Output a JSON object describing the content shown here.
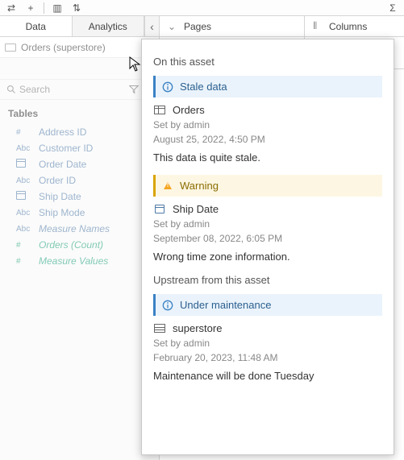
{
  "toolbar": {
    "icons": [
      "undo",
      "redo",
      "new-sheet",
      "duplicate",
      "swap",
      "sort-asc",
      "sort-desc",
      "highlight"
    ]
  },
  "side_tabs": {
    "data": "Data",
    "analytics": "Analytics"
  },
  "datasource": {
    "name": "Orders (superstore)"
  },
  "search": {
    "placeholder": "Search"
  },
  "section": {
    "tables": "Tables"
  },
  "fields": [
    {
      "type": "#",
      "cls": "dim",
      "name": "Address ID"
    },
    {
      "type": "Abc",
      "cls": "dim",
      "name": "Customer ID"
    },
    {
      "type": "cal",
      "cls": "dim",
      "name": "Order Date"
    },
    {
      "type": "Abc",
      "cls": "dim",
      "name": "Order ID"
    },
    {
      "type": "cal",
      "cls": "dim",
      "name": "Ship Date"
    },
    {
      "type": "Abc",
      "cls": "dim",
      "name": "Ship Mode"
    },
    {
      "type": "Abc",
      "cls": "dim italic",
      "name": "Measure Names"
    },
    {
      "type": "#",
      "cls": "mea italic",
      "name": "Orders (Count)"
    },
    {
      "type": "#",
      "cls": "mea italic",
      "name": "Measure Values"
    }
  ],
  "shelves": {
    "pages": "Pages",
    "columns": "Columns"
  },
  "popover": {
    "section1": "On this asset",
    "section2": "Upstream from this asset",
    "items": [
      {
        "banner_type": "info",
        "banner_label": "Stale data",
        "obj_label": "Orders",
        "obj_icon": "table",
        "set_by": "Set by admin",
        "timestamp": "August 25, 2022, 4:50 PM",
        "message": "This data is quite stale."
      },
      {
        "banner_type": "warn",
        "banner_label": "Warning",
        "obj_label": "Ship Date",
        "obj_icon": "calendar",
        "set_by": "Set by admin",
        "timestamp": "September 08, 2022, 6:05 PM",
        "message": "Wrong time zone information."
      },
      {
        "banner_type": "info",
        "banner_label": "Under maintenance",
        "obj_label": "superstore",
        "obj_icon": "database",
        "set_by": "Set by admin",
        "timestamp": "February 20, 2023, 11:48 AM",
        "message": "Maintenance will be done Tuesday"
      }
    ]
  }
}
